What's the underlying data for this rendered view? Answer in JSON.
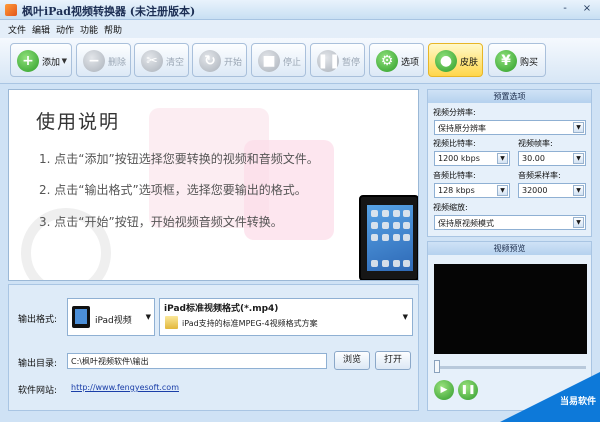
{
  "window": {
    "title": "枫叶iPad视频转换器  (未注册版本)",
    "minimize": "-",
    "close": "×"
  },
  "menu": [
    "文件",
    "编辑",
    "动作",
    "功能",
    "帮助"
  ],
  "toolbar": {
    "add": "添加",
    "delete": "删除",
    "clear": "清空",
    "start": "开始",
    "stop": "停止",
    "pause": "暂停",
    "options": "选项",
    "skin": "皮肤",
    "buy": "购买"
  },
  "instructions": {
    "title": "使用说明",
    "lines": [
      "1. 点击“添加”按钮选择您要转换的视频和音频文件。",
      "2. 点击“输出格式”选项框，选择您要输出的格式。",
      "3. 点击“开始”按钮，开始视频音频文件转换。"
    ]
  },
  "output": {
    "format_label": "输出格式:",
    "device": "iPad视频",
    "profile_name": "iPad标准视频格式(*.mp4)",
    "profile_desc": "iPad支持的标准MPEG-4视频格式方案",
    "dir_label": "输出目录:",
    "dir_value": "C:\\枫叶视频软件\\输出",
    "browse": "浏览",
    "open": "打开",
    "site_label": "软件网站:",
    "site_url": "http://www.fengyesoft.com"
  },
  "presets": {
    "header": "预置选项",
    "resolution_label": "视频分辨率:",
    "resolution_value": "保持原分辨率",
    "vbitrate_label": "视频比特率:",
    "vbitrate_value": "1200 kbps",
    "framerate_label": "视频帧率:",
    "framerate_value": "30.00",
    "abitrate_label": "音频比特率:",
    "abitrate_value": "128 kbps",
    "samplerate_label": "音频采样率:",
    "samplerate_value": "32000",
    "scale_label": "视频缩放:",
    "scale_value": "保持原视频模式"
  },
  "preview": {
    "header": "视频预览"
  },
  "watermark": {
    "text": "当易软件"
  },
  "colors": {
    "accent_green": "#2d9d28",
    "active_skin": "#ffd64a",
    "link": "#1a3ea8"
  }
}
